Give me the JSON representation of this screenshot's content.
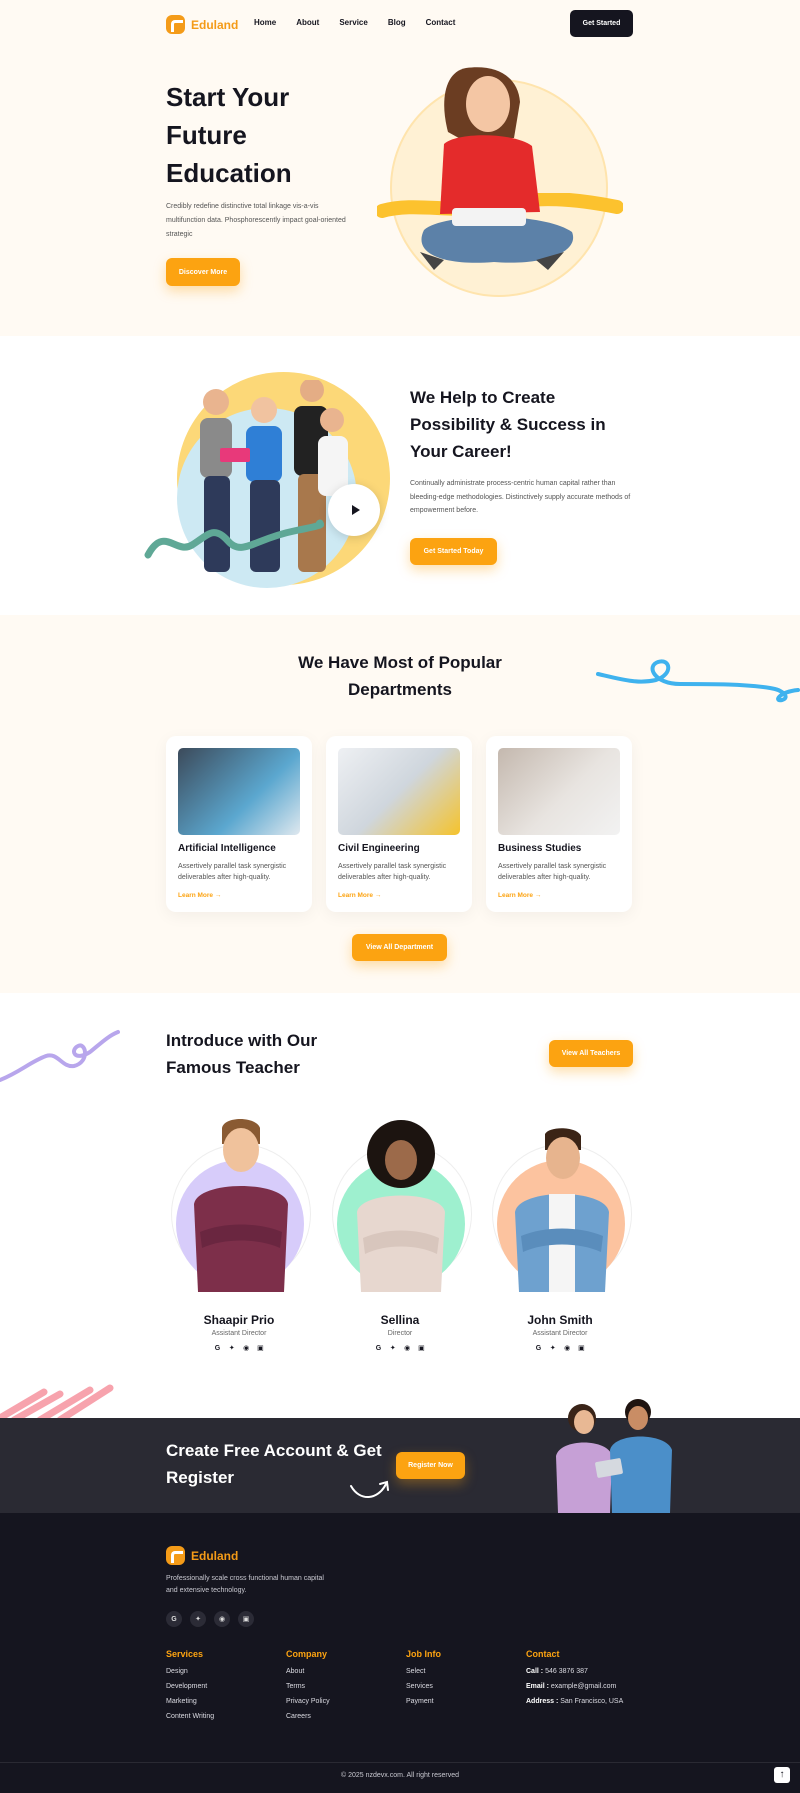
{
  "brand": {
    "name": "Eduland",
    "accent": "#fca311",
    "dark": "#15151f"
  },
  "nav": {
    "links": [
      "Home",
      "About",
      "Service",
      "Blog",
      "Contact"
    ],
    "cta": "Get Started"
  },
  "hero": {
    "title": "Start Your Future Education",
    "text": "Credibly redefine distinctive total linkage vis-a-vis multifunction data. Phosphorescently impact goal-oriented strategic",
    "button": "Discover More"
  },
  "about": {
    "title": "We Help to Create Possibility & Success in Your Career!",
    "text": "Continually administrate process-centric human capital rather than bleeding-edge methodologies. Distinctively supply accurate methods of empowerment before.",
    "button": "Get Started Today"
  },
  "departments": {
    "title": "We Have Most of Popular Departments",
    "cards": [
      {
        "title": "Artificial Intelligence",
        "text": "Assertively parallel task synergistic deliverables after high-quality.",
        "link": "Learn More"
      },
      {
        "title": "Civil Engineering",
        "text": "Assertively parallel task synergistic deliverables after high-quality.",
        "link": "Learn More"
      },
      {
        "title": "Business Studies",
        "text": "Assertively parallel task synergistic deliverables after high-quality.",
        "link": "Learn More"
      }
    ],
    "button": "View All Department"
  },
  "teachers": {
    "title": "Introduce with Our Famous Teacher",
    "button": "View All Teachers",
    "list": [
      {
        "name": "Shaapir Prio",
        "role": "Assistant Director",
        "color": "#d7ccfa"
      },
      {
        "name": "Sellina",
        "role": "Director",
        "color": "#9ef0cf"
      },
      {
        "name": "John Smith",
        "role": "Assistant Director",
        "color": "#fcc39f"
      }
    ],
    "social_icons": [
      "google-icon",
      "twitter-icon",
      "instagram-icon",
      "linkedin-icon"
    ]
  },
  "cta": {
    "title": "Create Free Account & Get Register",
    "button": "Register Now"
  },
  "footer": {
    "about": "Professionally scale cross functional human capital and extensive technology.",
    "columns": [
      {
        "title": "Services",
        "items": [
          "Design",
          "Development",
          "Marketing",
          "Content Writing"
        ]
      },
      {
        "title": "Company",
        "items": [
          "About",
          "Terms",
          "Privacy Policy",
          "Careers"
        ]
      },
      {
        "title": "Job Info",
        "items": [
          "Select",
          "Services",
          "Payment"
        ]
      }
    ],
    "contact": {
      "title": "Contact",
      "call_label": "Call :",
      "call": "546 3876 387",
      "email_label": "Email :",
      "email": "example@gmail.com",
      "address_label": "Address :",
      "address": "San Francisco, USA"
    },
    "copyright": "© 2025 nzdevx.com. All right reserved"
  }
}
